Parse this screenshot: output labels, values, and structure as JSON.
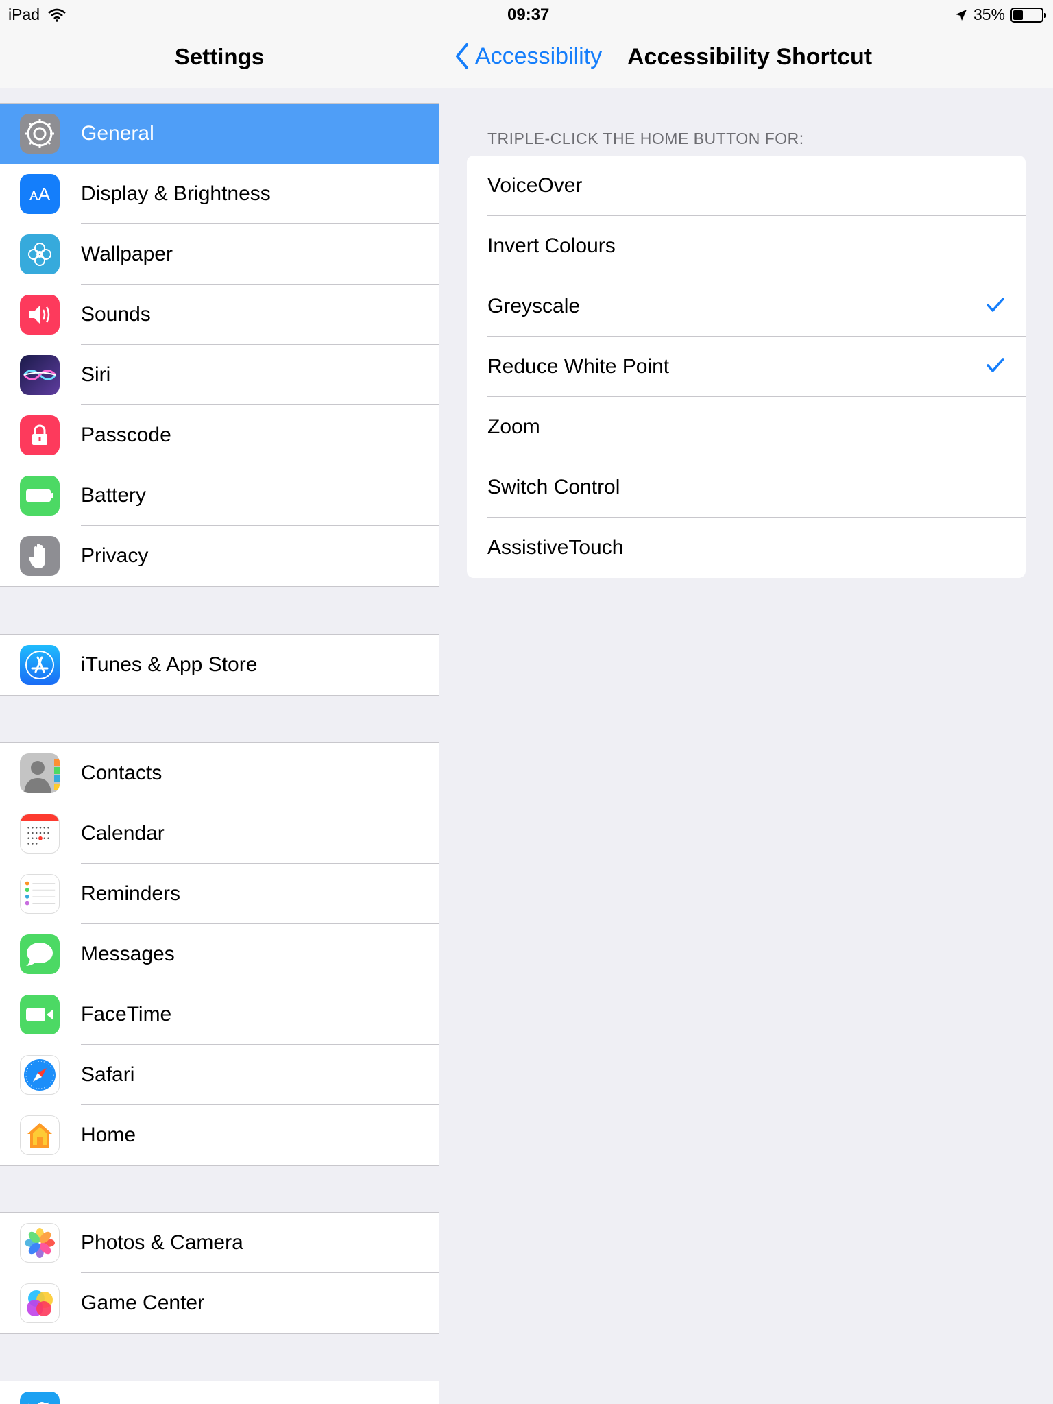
{
  "status_bar": {
    "device": "iPad",
    "time": "09:37",
    "battery_percent": "35%",
    "battery_level": 0.35
  },
  "left_nav": {
    "title": "Settings"
  },
  "settings_groups": [
    {
      "items": [
        {
          "label": "General",
          "icon": "gear-icon",
          "color": "#8e8e93",
          "selected": true
        },
        {
          "label": "Display & Brightness",
          "icon": "text-size-icon",
          "color": "#147efb"
        },
        {
          "label": "Wallpaper",
          "icon": "flower-icon",
          "color": "#36aadc"
        },
        {
          "label": "Sounds",
          "icon": "speaker-icon",
          "color": "#fd3a5c"
        },
        {
          "label": "Siri",
          "icon": "siri-icon",
          "color": "#2b2b6e"
        },
        {
          "label": "Passcode",
          "icon": "lock-icon",
          "color": "#fd3a5c"
        },
        {
          "label": "Battery",
          "icon": "battery-icon",
          "color": "#4cd964"
        },
        {
          "label": "Privacy",
          "icon": "hand-icon",
          "color": "#8e8e93"
        }
      ]
    },
    {
      "items": [
        {
          "label": "iTunes & App Store",
          "icon": "app-store-icon",
          "color": "#1a8cfa"
        }
      ]
    },
    {
      "items": [
        {
          "label": "Contacts",
          "icon": "contacts-icon",
          "color": "#b5b5b5"
        },
        {
          "label": "Calendar",
          "icon": "calendar-icon",
          "color": "#ffffff"
        },
        {
          "label": "Reminders",
          "icon": "reminders-icon",
          "color": "#ffffff"
        },
        {
          "label": "Messages",
          "icon": "messages-icon",
          "color": "#4cd964"
        },
        {
          "label": "FaceTime",
          "icon": "facetime-icon",
          "color": "#4cd964"
        },
        {
          "label": "Safari",
          "icon": "safari-icon",
          "color": "#ffffff"
        },
        {
          "label": "Home",
          "icon": "home-icon",
          "color": "#ffffff"
        }
      ]
    },
    {
      "items": [
        {
          "label": "Photos & Camera",
          "icon": "photos-icon",
          "color": "#ffffff"
        },
        {
          "label": "Game Center",
          "icon": "game-center-icon",
          "color": "#ffffff"
        }
      ]
    }
  ],
  "right_nav": {
    "back_label": "Accessibility",
    "title": "Accessibility Shortcut"
  },
  "shortcut_section": {
    "header": "TRIPLE-CLICK THE HOME BUTTON FOR:",
    "options": [
      {
        "label": "VoiceOver",
        "checked": false
      },
      {
        "label": "Invert Colours",
        "checked": false
      },
      {
        "label": "Greyscale",
        "checked": true
      },
      {
        "label": "Reduce White Point",
        "checked": true
      },
      {
        "label": "Zoom",
        "checked": false
      },
      {
        "label": "Switch Control",
        "checked": false
      },
      {
        "label": "AssistiveTouch",
        "checked": false
      }
    ]
  },
  "colors": {
    "accent": "#157efb",
    "selected_row": "#4f9ef7"
  }
}
